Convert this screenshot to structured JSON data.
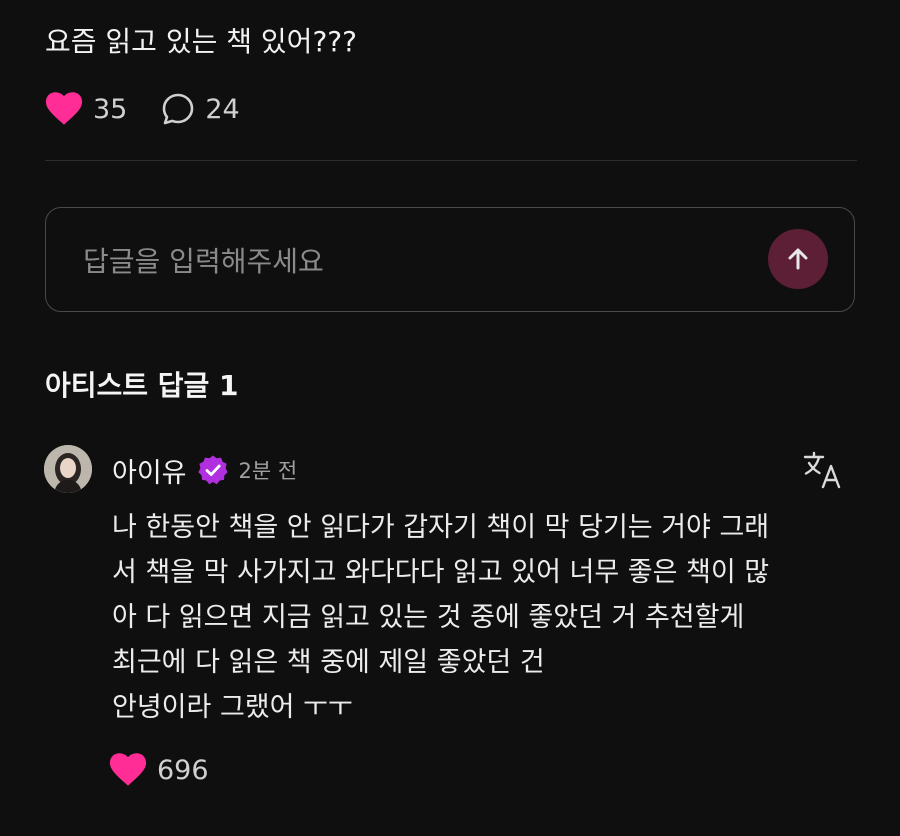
{
  "post": {
    "title": "요즘 읽고 있는 책 있어???",
    "likes": "35",
    "comments": "24"
  },
  "reply": {
    "placeholder": "답글을 입력해주세요"
  },
  "section": {
    "title": "아티스트 답글 1"
  },
  "comment": {
    "author": "아이유",
    "time": "2분 전",
    "lines": [
      "나 한동안 책을 안 읽다가 갑자기 책이 막 당기는 거야 그래",
      "서 책을 막 사가지고 와다다다 읽고 있어 너무 좋은 책이 많",
      "아 다 읽으면 지금 읽고 있는 것 중에 좋았던 거 추천할게",
      "최근에 다 읽은 책 중에 제일 좋았던 건",
      "안녕이라 그랬어 ㅜㅜ"
    ],
    "likes": "696"
  },
  "icons": {
    "like": "heart-icon",
    "comment": "speech-bubble-icon",
    "send": "arrow-up-icon",
    "verified": "verified-badge-icon",
    "translate": "translate-icon"
  },
  "colors": {
    "background": "#0f0f0f",
    "heart": "#ff2d95",
    "verified": "#b030e0",
    "send_button": "#5c1f36"
  }
}
